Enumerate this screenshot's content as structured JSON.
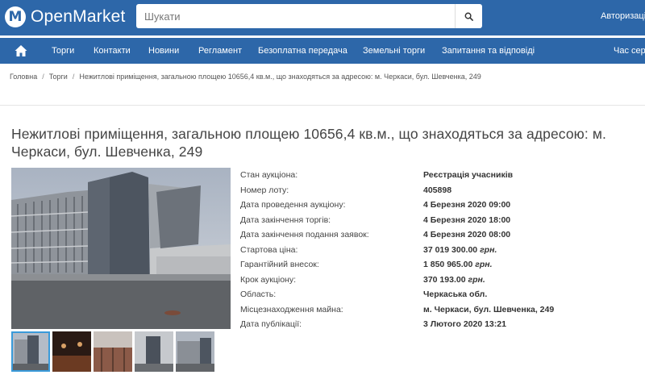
{
  "header": {
    "logo_text": "OpenMarket",
    "logo_mark": "M",
    "search_placeholder": "Шукати",
    "login_label": "Авторизація"
  },
  "nav": {
    "items": [
      "Торги",
      "Контакти",
      "Новини",
      "Регламент",
      "Безоплатна передача",
      "Земельні торги",
      "Запитання та відповіді",
      "Час сер"
    ]
  },
  "breadcrumb": {
    "items": [
      "Головна",
      "Торги",
      "Нежитлові приміщення, загальною площею 10656,4 кв.м., що знаходяться за адресою: м. Черкаси, бул. Шевченка, 249"
    ]
  },
  "lot": {
    "title": "Нежитлові приміщення, загальною площею 10656,4 кв.м., що знаходяться за адресою: м. Черкаси, бул. Шевченка, 249",
    "details": [
      {
        "label": "Стан аукціона:",
        "value": "Реєстрація учасників"
      },
      {
        "label": "Номер лоту:",
        "value": "405898"
      },
      {
        "label": "Дата проведення аукціону:",
        "value": "4 Березня 2020 09:00"
      },
      {
        "label": "Дата закінчення торгів:",
        "value": "4 Березня 2020 18:00"
      },
      {
        "label": "Дата закінчення подання заявок:",
        "value": "4 Березня 2020 08:00"
      },
      {
        "label": "Стартова ціна:",
        "value": "37 019 300.00",
        "unit": "грн."
      },
      {
        "label": "Гарантійний внесок:",
        "value": "1 850 965.00",
        "unit": "грн."
      },
      {
        "label": "Крок аукціону:",
        "value": "370 193.00",
        "unit": "грн."
      },
      {
        "label": "Область:",
        "value": "Черкаська обл."
      },
      {
        "label": "Місцезнаходження майна:",
        "value": "м. Черкаси, бул. Шевченка, 249"
      },
      {
        "label": "Дата публікації:",
        "value": "3 Лютого 2020 13:21"
      }
    ]
  },
  "colors": {
    "brand_blue": "#2d67a9",
    "thumb_active": "#3a9ad9"
  },
  "icons": [
    "logo-icon",
    "search-icon",
    "home-icon"
  ]
}
